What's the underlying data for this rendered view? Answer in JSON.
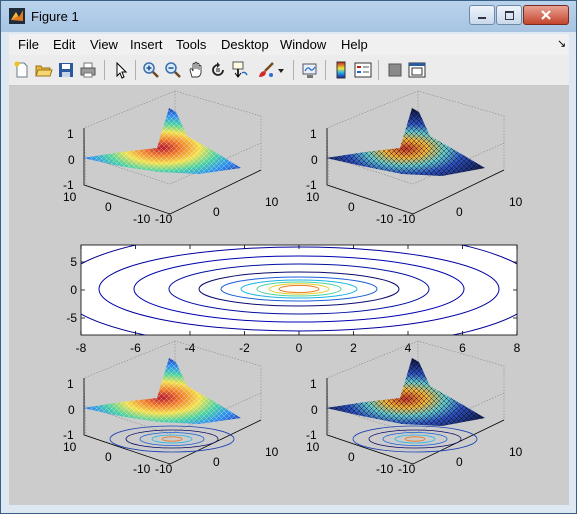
{
  "window": {
    "title": "Figure 1"
  },
  "menu": [
    "File",
    "Edit",
    "View",
    "Insert",
    "Tools",
    "Desktop",
    "Window",
    "Help"
  ],
  "menu_arrow": "↘",
  "toolbar_icons": [
    "new-figure-icon",
    "open-file-icon",
    "save-icon",
    "print-icon",
    "edit-plot-arrow-icon",
    "zoom-in-icon",
    "zoom-out-icon",
    "pan-hand-icon",
    "rotate-3d-icon",
    "data-cursor-icon",
    "brush-icon",
    "brush-dropdown-icon",
    "link-plot-icon",
    "colorbar-icon",
    "legend-icon",
    "hide-plot-tools-icon",
    "show-plot-tools-icon"
  ],
  "subplot_top_left": {
    "z_ticks": [
      "1",
      "0",
      "-1"
    ],
    "left_ticks": [
      "10",
      "0",
      "-10"
    ],
    "right_ticks": [
      "-10",
      "0",
      "10"
    ]
  },
  "subplot_top_right": {
    "z_ticks": [
      "1",
      "0",
      "-1"
    ],
    "left_ticks": [
      "10",
      "0",
      "-10"
    ],
    "right_ticks": [
      "-10",
      "0",
      "10"
    ]
  },
  "subplot_middle": {
    "x_ticks": [
      "-8",
      "-6",
      "-4",
      "-2",
      "0",
      "2",
      "4",
      "6",
      "8"
    ],
    "y_ticks": [
      "5",
      "0",
      "-5"
    ]
  },
  "subplot_bottom_left": {
    "z_ticks": [
      "1",
      "0",
      "-1"
    ],
    "left_ticks": [
      "10",
      "0",
      "-10"
    ],
    "right_ticks": [
      "-10",
      "0",
      "10"
    ]
  },
  "subplot_bottom_right": {
    "z_ticks": [
      "1",
      "0",
      "-1"
    ],
    "left_ticks": [
      "10",
      "0",
      "-10"
    ],
    "right_ticks": [
      "-10",
      "0",
      "10"
    ]
  }
}
